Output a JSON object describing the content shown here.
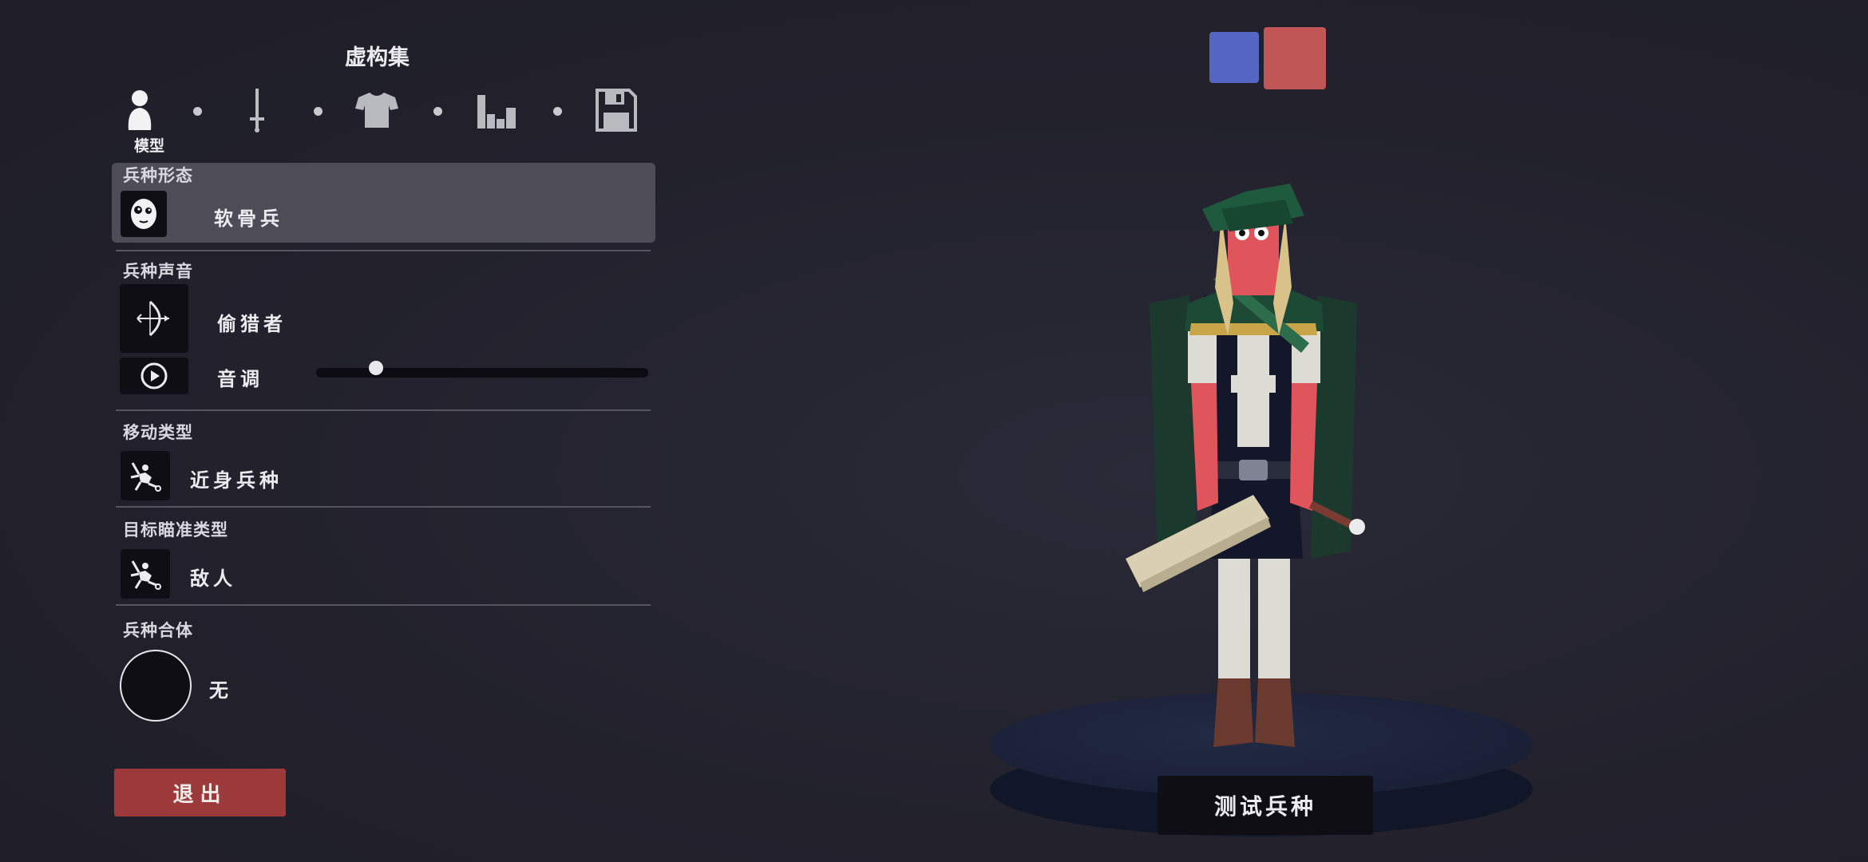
{
  "header": {
    "title": "虚构集"
  },
  "tabs": [
    {
      "name": "model",
      "icon": "person-icon",
      "label": "模型",
      "active": true
    },
    {
      "name": "weapons",
      "icon": "sword-icon",
      "label": ""
    },
    {
      "name": "clothing",
      "icon": "shirt-icon",
      "label": ""
    },
    {
      "name": "abilities",
      "icon": "bars-icon",
      "label": ""
    },
    {
      "name": "save",
      "icon": "floppy-disk-icon",
      "label": ""
    }
  ],
  "sections": {
    "unit_form": {
      "label": "兵种形态",
      "value": "软骨兵",
      "icon": "ragdoll-face-icon"
    },
    "unit_voice": {
      "label": "兵种声音",
      "value": "偷猎者",
      "icon": "bow-icon",
      "pitch_label": "音调",
      "pitch_level": 0.18,
      "play_icon": "play-icon"
    },
    "movement": {
      "label": "移动类型",
      "value": "近身兵种",
      "icon": "melee-unit-icon"
    },
    "targeting": {
      "label": "目标瞄准类型",
      "value": "敌人",
      "icon": "melee-unit-icon"
    },
    "combine": {
      "label": "兵种合体",
      "value": "无"
    }
  },
  "actions": {
    "exit_label": "退出",
    "test_label": "测试兵种"
  },
  "team_colors": {
    "blue": "#5565c2",
    "red": "#c05655",
    "selected": "red"
  }
}
